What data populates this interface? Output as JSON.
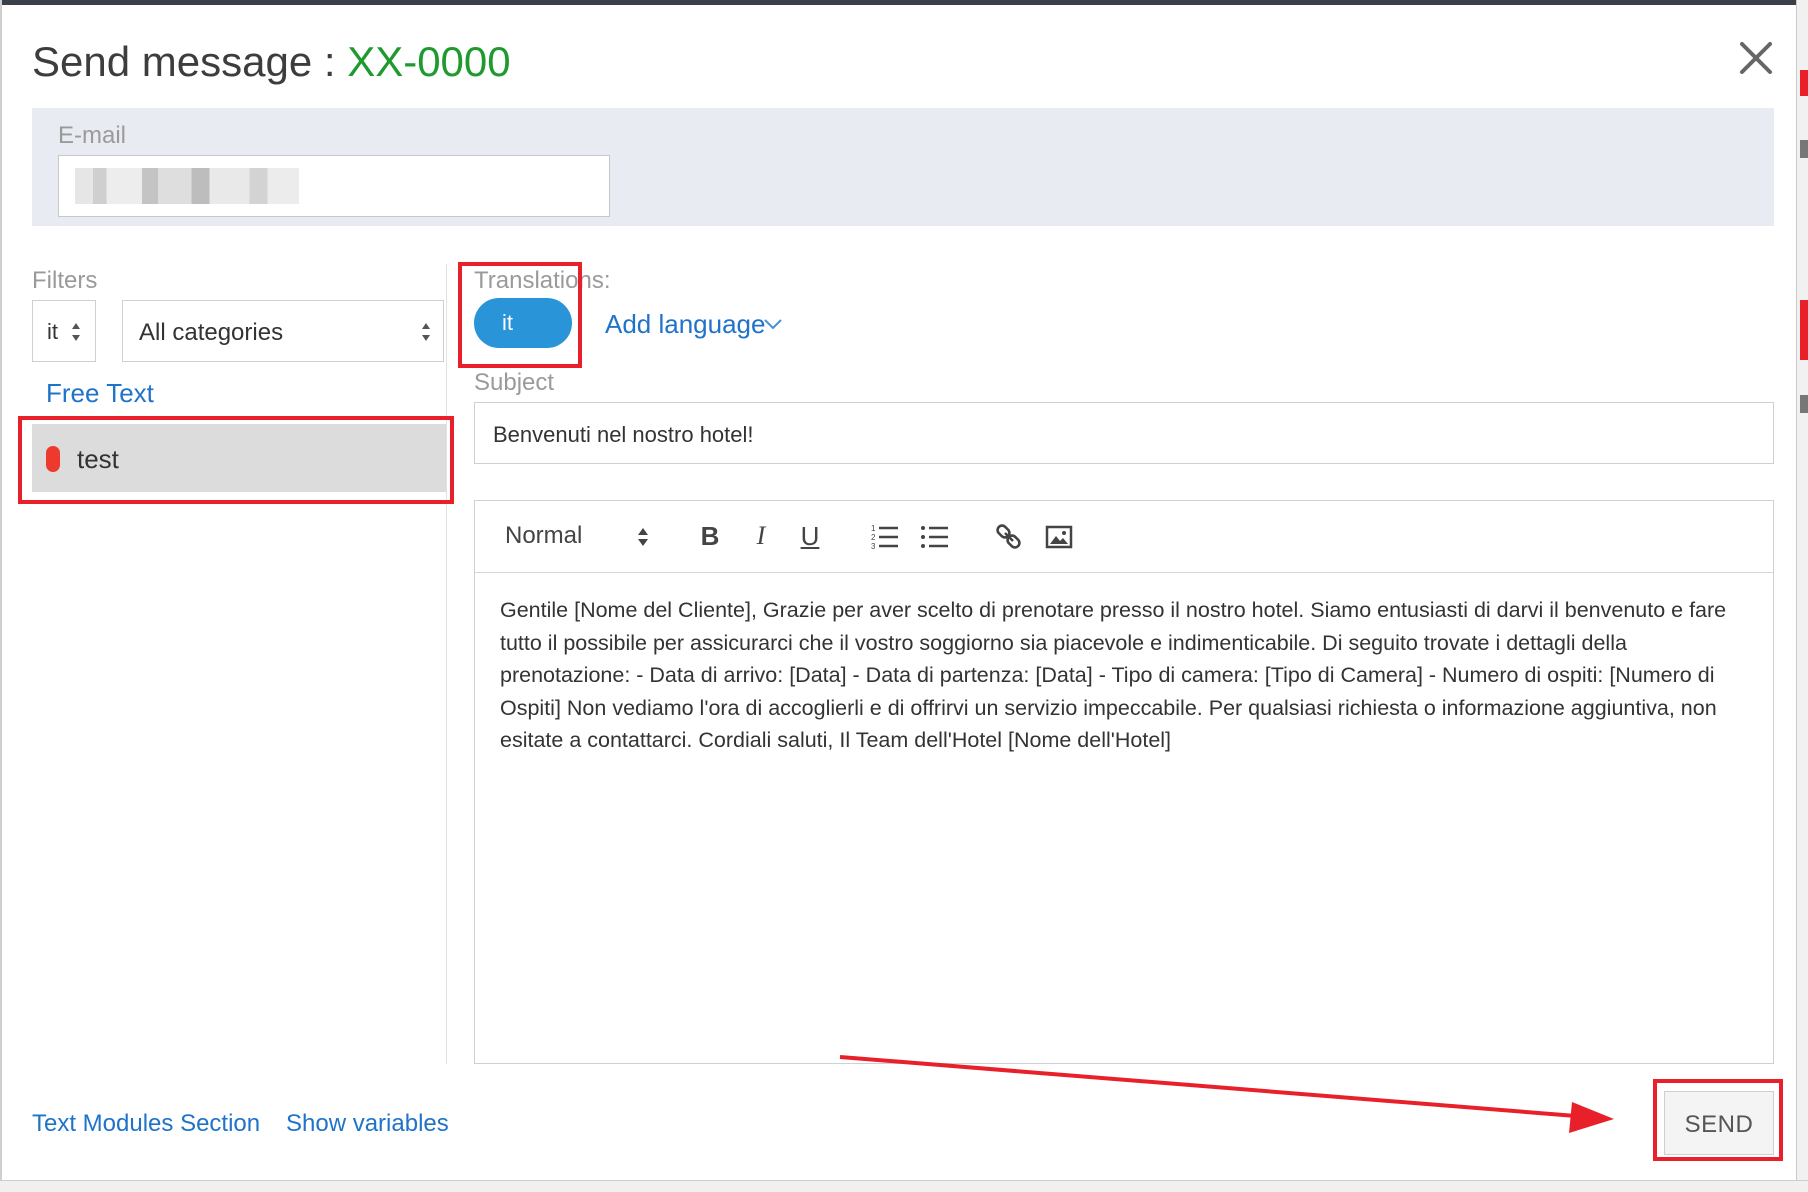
{
  "dialog": {
    "title": "Send message :",
    "code": "XX-0000"
  },
  "email": {
    "label": "E-mail"
  },
  "filters": {
    "label": "Filters",
    "language": "it",
    "category": "All categories",
    "free_text_link": "Free Text",
    "modules": [
      {
        "label": "test",
        "color": "#ee3a2e"
      }
    ]
  },
  "translations": {
    "label": "Translations:",
    "active_language": "it",
    "add_language_label": "Add language"
  },
  "subject": {
    "label": "Subject",
    "value": "Benvenuti nel nostro hotel!"
  },
  "editor": {
    "format": "Normal",
    "bold_label": "B",
    "italic_label": "I",
    "underline_label": "U",
    "body": "Gentile [Nome del Cliente], Grazie per aver scelto di prenotare presso il nostro hotel. Siamo entusiasti di darvi il benvenuto e fare tutto il possibile per assicurarci che il vostro soggiorno sia piacevole e indimenticabile. Di seguito trovate i dettagli della prenotazione: - Data di arrivo: [Data] - Data di partenza: [Data] - Tipo di camera: [Tipo di Camera] - Numero di ospiti: [Numero di Ospiti] Non vediamo l'ora di accoglierli e di offrirvi un servizio impeccabile. Per qualsiasi richiesta o informazione aggiuntiva, non esitate a contattarci. Cordiali saluti, Il Team dell'Hotel [Nome dell'Hotel]"
  },
  "footer": {
    "text_modules_link": "Text Modules Section",
    "show_variables_link": "Show variables",
    "send_label": "SEND"
  },
  "colors": {
    "accent": "#2a94d8",
    "link": "#1f73c9",
    "code": "#1f9a2e",
    "annotation": "#e8202a"
  }
}
